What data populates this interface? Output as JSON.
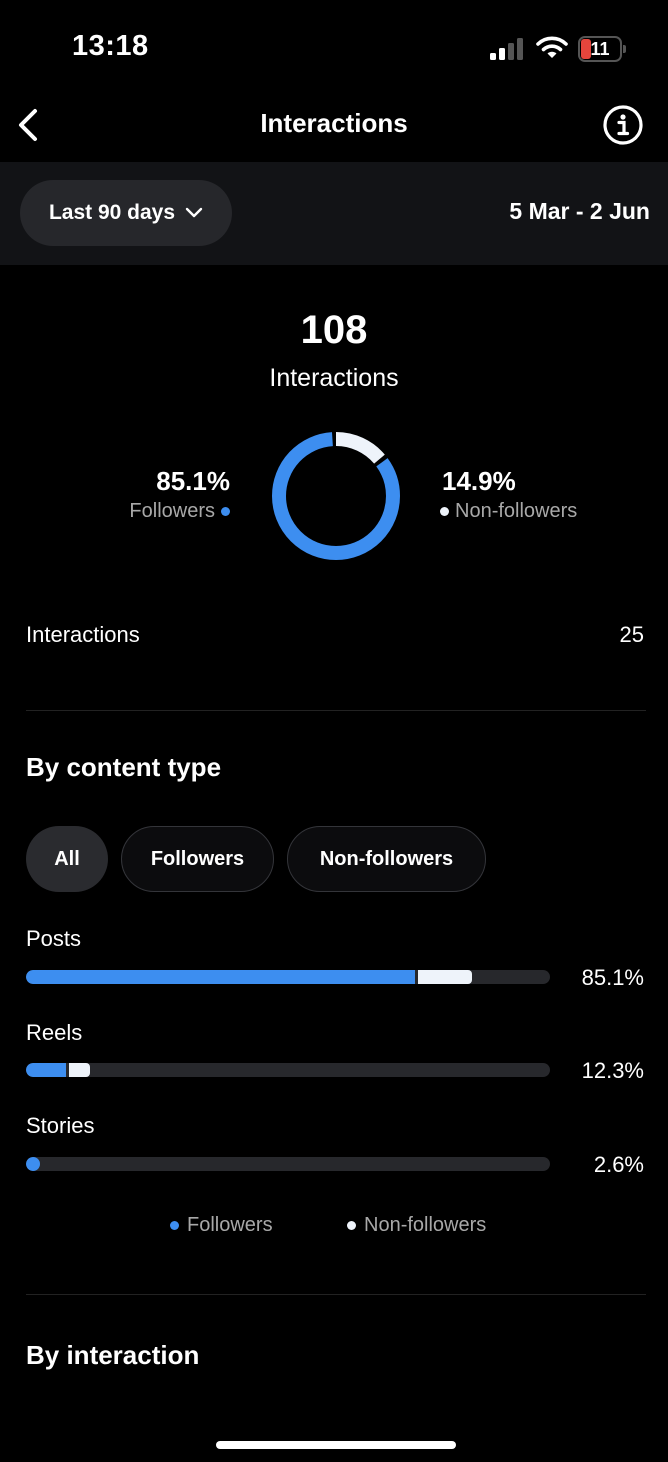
{
  "status_bar": {
    "time": "13:18",
    "battery_level": "11",
    "signal_icon": "cellular-signal-icon",
    "wifi_icon": "wifi-icon"
  },
  "header": {
    "title": "Interactions",
    "back_icon": "chevron-left-icon",
    "info_icon": "info-icon"
  },
  "filter": {
    "range_label": "Last 90 days",
    "range_icon": "chevron-down-icon",
    "date_range": "5 Mar - 2 Jun"
  },
  "summary": {
    "total": "108",
    "total_label": "Interactions",
    "followers_pct": "85.1%",
    "followers_label": "Followers",
    "non_followers_pct": "14.9%",
    "non_followers_label": "Non-followers",
    "donut": {
      "followers": 85.1,
      "non_followers": 14.9
    }
  },
  "interactions_row": {
    "label": "Interactions",
    "value": "25"
  },
  "content_type": {
    "title": "By content type",
    "chips": [
      {
        "label": "All",
        "active": true
      },
      {
        "label": "Followers",
        "active": false
      },
      {
        "label": "Non-followers",
        "active": false
      }
    ],
    "bars": [
      {
        "label": "Posts",
        "percent_label": "85.1%",
        "followers": 74.2,
        "non_followers": 10.9
      },
      {
        "label": "Reels",
        "percent_label": "12.3%",
        "followers": 7.7,
        "non_followers": 4.6
      },
      {
        "label": "Stories",
        "percent_label": "2.6%",
        "followers": 2.6,
        "non_followers": 0
      }
    ],
    "legend": {
      "followers": "Followers",
      "non_followers": "Non-followers"
    }
  },
  "by_interaction": {
    "title": "By interaction"
  },
  "colors": {
    "followers": "#3d8ef0",
    "non_followers": "#eef3fa",
    "track": "#27282c"
  }
}
